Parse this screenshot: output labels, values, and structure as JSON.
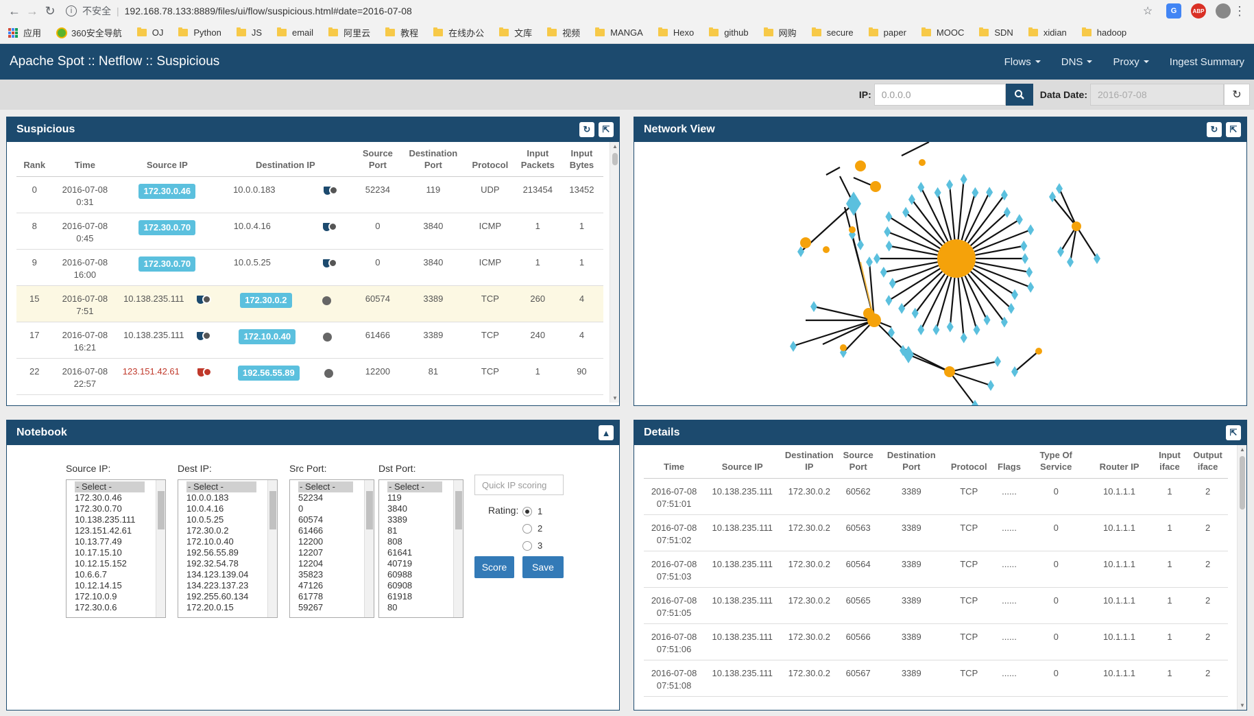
{
  "browser": {
    "security_label": "不安全",
    "url": "192.168.78.133:8889/files/ui/flow/suspicious.html#date=2016-07-08",
    "bookmarks": [
      "应用",
      "360安全导航",
      "OJ",
      "Python",
      "JS",
      "email",
      "阿里云",
      "教程",
      "在线办公",
      "文库",
      "视频",
      "MANGA",
      "Hexo",
      "github",
      "网购",
      "secure",
      "paper",
      "MOOC",
      "SDN",
      "xidian",
      "hadoop"
    ]
  },
  "navbar": {
    "title": "Apache Spot :: Netflow :: Suspicious",
    "menu": [
      "Flows",
      "DNS",
      "Proxy",
      "Ingest Summary"
    ]
  },
  "filter": {
    "ip_label": "IP:",
    "ip_placeholder": "0.0.0.0",
    "date_label": "Data Date:",
    "date_value": "2016-07-08"
  },
  "suspicious": {
    "title": "Suspicious",
    "columns": [
      "Rank",
      "Time",
      "Source IP",
      "Destination IP",
      "Source Port",
      "Destination Port",
      "Protocol",
      "Input Packets",
      "Input Bytes"
    ],
    "rows": [
      {
        "rank": "0",
        "date": "2016-07-08",
        "time": "0:31",
        "src": "172.30.0.46",
        "dst": "10.0.0.183",
        "sport": "52234",
        "dport": "119",
        "proto": "UDP",
        "pkts": "213454",
        "bytes": "13452"
      },
      {
        "rank": "8",
        "date": "2016-07-08",
        "time": "0:45",
        "src": "172.30.0.70",
        "dst": "10.0.4.16",
        "sport": "0",
        "dport": "3840",
        "proto": "ICMP",
        "pkts": "1",
        "bytes": "1"
      },
      {
        "rank": "9",
        "date": "2016-07-08",
        "time": "16:00",
        "src": "172.30.0.70",
        "dst": "10.0.5.25",
        "sport": "0",
        "dport": "3840",
        "proto": "ICMP",
        "pkts": "1",
        "bytes": "1"
      },
      {
        "rank": "15",
        "date": "2016-07-08",
        "time": "7:51",
        "src": "10.138.235.111",
        "dst": "172.30.0.2",
        "sport": "60574",
        "dport": "3389",
        "proto": "TCP",
        "pkts": "260",
        "bytes": "4"
      },
      {
        "rank": "17",
        "date": "2016-07-08",
        "time": "16:21",
        "src": "10.138.235.111",
        "dst": "172.10.0.40",
        "sport": "61466",
        "dport": "3389",
        "proto": "TCP",
        "pkts": "240",
        "bytes": "4"
      },
      {
        "rank": "22",
        "date": "2016-07-08",
        "time": "22:57",
        "src": "123.151.42.61",
        "dst": "192.56.55.89",
        "sport": "12200",
        "dport": "81",
        "proto": "TCP",
        "pkts": "1",
        "bytes": "90"
      }
    ]
  },
  "network": {
    "title": "Network View"
  },
  "notebook": {
    "title": "Notebook",
    "source_ip_label": "Source IP:",
    "dest_ip_label": "Dest IP:",
    "src_port_label": "Src Port:",
    "dst_port_label": "Dst Port:",
    "select_placeholder": "- Select -",
    "source_ips": [
      "172.30.0.46",
      "172.30.0.70",
      "10.138.235.111",
      "123.151.42.61",
      "10.13.77.49",
      "10.17.15.10",
      "10.12.15.152",
      "10.6.6.7",
      "10.12.14.15",
      "172.10.0.9",
      "172.30.0.6"
    ],
    "dest_ips": [
      "10.0.0.183",
      "10.0.4.16",
      "10.0.5.25",
      "172.30.0.2",
      "172.10.0.40",
      "192.56.55.89",
      "192.32.54.78",
      "134.123.139.04",
      "134.223.137.23",
      "192.255.60.134",
      "172.20.0.15"
    ],
    "src_ports": [
      "52234",
      "0",
      "60574",
      "61466",
      "12200",
      "12207",
      "12204",
      "35823",
      "47126",
      "61778",
      "59267"
    ],
    "dst_ports": [
      "119",
      "3840",
      "3389",
      "81",
      "808",
      "61641",
      "40719",
      "60988",
      "60908",
      "61918",
      "80"
    ],
    "quick_ip_placeholder": "Quick IP scoring",
    "rating_label": "Rating:",
    "ratings": [
      "1",
      "2",
      "3"
    ],
    "score_label": "Score",
    "save_label": "Save"
  },
  "details": {
    "title": "Details",
    "columns": [
      "Time",
      "Source IP",
      "Destination IP",
      "Source Port",
      "Destination Port",
      "Protocol",
      "Flags",
      "Type Of Service",
      "Router IP",
      "Input iface",
      "Output iface"
    ],
    "rows": [
      {
        "date": "2016-07-08",
        "time": "07:51:01",
        "src": "10.138.235.111",
        "dst": "172.30.0.2",
        "sport": "60562",
        "dport": "3389",
        "proto": "TCP",
        "flags": "......",
        "tos": "0",
        "router": "10.1.1.1",
        "in": "1",
        "out": "2"
      },
      {
        "date": "2016-07-08",
        "time": "07:51:02",
        "src": "10.138.235.111",
        "dst": "172.30.0.2",
        "sport": "60563",
        "dport": "3389",
        "proto": "TCP",
        "flags": "......",
        "tos": "0",
        "router": "10.1.1.1",
        "in": "1",
        "out": "2"
      },
      {
        "date": "2016-07-08",
        "time": "07:51:03",
        "src": "10.138.235.111",
        "dst": "172.30.0.2",
        "sport": "60564",
        "dport": "3389",
        "proto": "TCP",
        "flags": "......",
        "tos": "0",
        "router": "10.1.1.1",
        "in": "1",
        "out": "2"
      },
      {
        "date": "2016-07-08",
        "time": "07:51:05",
        "src": "10.138.235.111",
        "dst": "172.30.0.2",
        "sport": "60565",
        "dport": "3389",
        "proto": "TCP",
        "flags": "......",
        "tos": "0",
        "router": "10.1.1.1",
        "in": "1",
        "out": "2"
      },
      {
        "date": "2016-07-08",
        "time": "07:51:06",
        "src": "10.138.235.111",
        "dst": "172.30.0.2",
        "sport": "60566",
        "dport": "3389",
        "proto": "TCP",
        "flags": "......",
        "tos": "0",
        "router": "10.1.1.1",
        "in": "1",
        "out": "2"
      },
      {
        "date": "2016-07-08",
        "time": "07:51:08",
        "src": "10.138.235.111",
        "dst": "172.30.0.2",
        "sport": "60567",
        "dport": "3389",
        "proto": "TCP",
        "flags": "......",
        "tos": "0",
        "router": "10.1.1.1",
        "in": "1",
        "out": "2"
      }
    ]
  },
  "colors": {
    "brand": "#1c4a6e",
    "badge": "#5bc0de",
    "node_orange": "#f5a20a",
    "node_blue": "#5bc0de",
    "highlight_row": "#fcf8e3"
  }
}
